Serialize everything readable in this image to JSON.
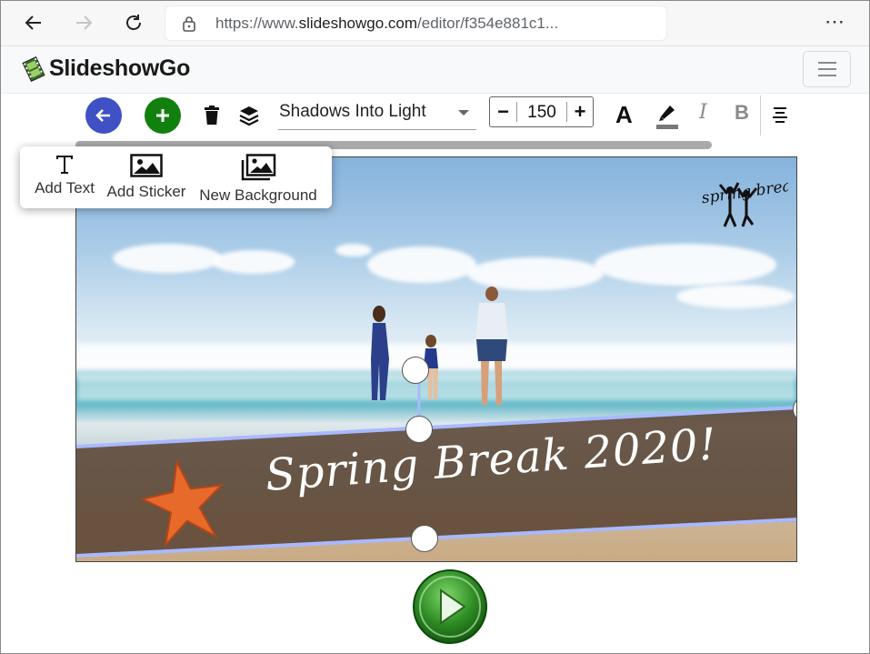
{
  "browser": {
    "url_prefix": "https://www.",
    "url_domain": "slideshowgo.com",
    "url_rest": "/editor/f354e881c1..."
  },
  "app": {
    "name": "SlideshowGo"
  },
  "toolbar": {
    "font_name": "Shadows Into Light",
    "font_size": "150",
    "minus_label": "−",
    "plus_label": "+",
    "bold_A": "A",
    "italic": "I",
    "bold": "B"
  },
  "menu": {
    "items": [
      {
        "label": "Add Text",
        "icon": "text-icon"
      },
      {
        "label": "Add Sticker",
        "icon": "image-icon"
      },
      {
        "label": "New Background",
        "icon": "images-icon"
      }
    ]
  },
  "canvas": {
    "banner_text": "Spring Break 2020!",
    "sticker_text": "spring break"
  },
  "colors": {
    "back_button": "#3f51c4",
    "add_button": "#12800f",
    "banner": "#5b4634",
    "handle_line": "#a9b9ff",
    "play": "#2e8b24"
  }
}
